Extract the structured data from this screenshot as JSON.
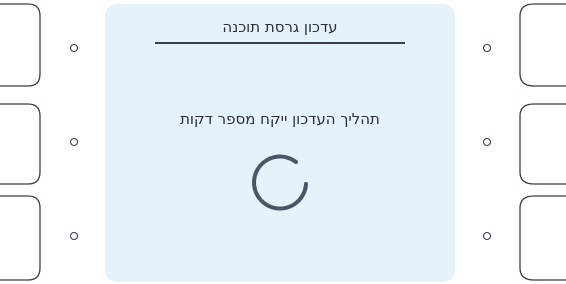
{
  "dialog": {
    "title": "עדכון גרסת תוכנה",
    "message": "תהליך העדכון ייקח מספר דקות"
  },
  "spinner": {
    "icon": "loading-spinner-icon"
  },
  "colors": {
    "panel_background": "#e4f2fb",
    "bezel_stroke": "#3a3f4a",
    "text": "#2b2f3a",
    "spinner": "#4a5566"
  },
  "left_softkeys": [
    {
      "name": "softkey-left-1"
    },
    {
      "name": "softkey-left-2"
    },
    {
      "name": "softkey-left-3"
    }
  ],
  "right_softkeys": [
    {
      "name": "softkey-right-1"
    },
    {
      "name": "softkey-right-2"
    },
    {
      "name": "softkey-right-3"
    }
  ]
}
